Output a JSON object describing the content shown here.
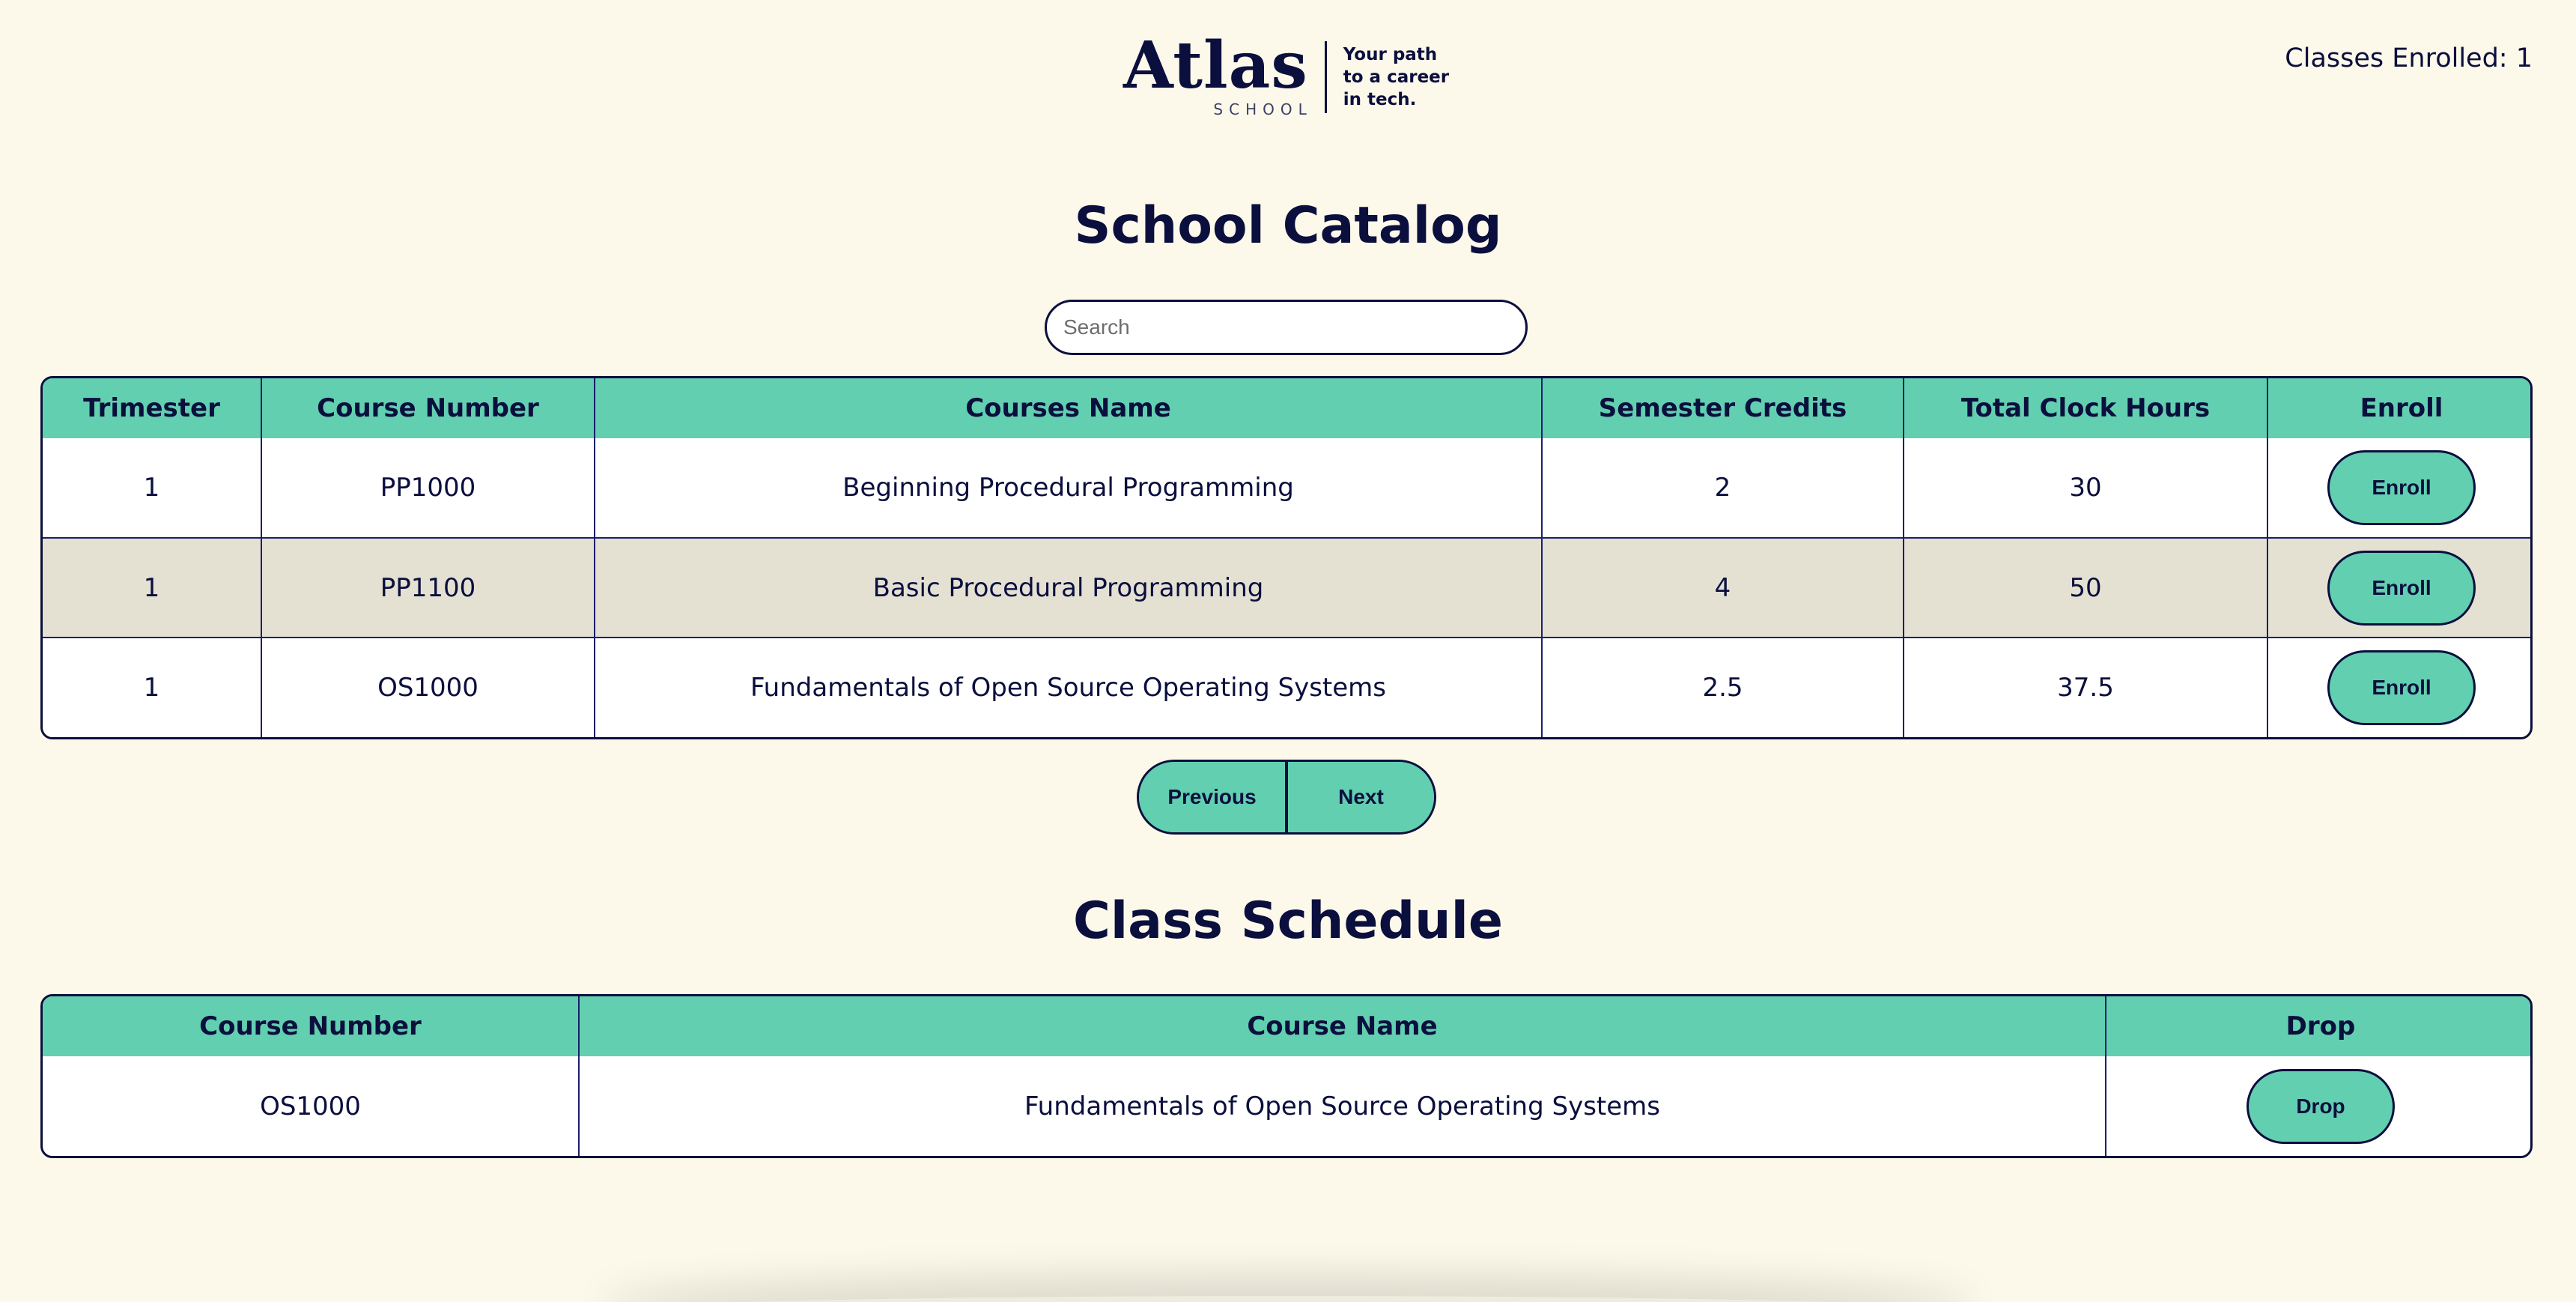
{
  "header": {
    "logo_title": "Atlas",
    "logo_sub": "SCHOOL",
    "logo_tagline": [
      "Your path",
      "to a career",
      "in tech."
    ],
    "enrolled_text": "Classes Enrolled: 1"
  },
  "catalog": {
    "title": "School Catalog",
    "search_placeholder": "Search",
    "columns": [
      "Trimester",
      "Course Number",
      "Courses Name",
      "Semester Credits",
      "Total Clock Hours",
      "Enroll"
    ],
    "rows": [
      {
        "trimester": "1",
        "number": "PP1000",
        "name": "Beginning Procedural Programming",
        "credits": "2",
        "hours": "30",
        "action": "Enroll"
      },
      {
        "trimester": "1",
        "number": "PP1100",
        "name": "Basic Procedural Programming",
        "credits": "4",
        "hours": "50",
        "action": "Enroll"
      },
      {
        "trimester": "1",
        "number": "OS1000",
        "name": "Fundamentals of Open Source Operating Systems",
        "credits": "2.5",
        "hours": "37.5",
        "action": "Enroll"
      }
    ],
    "pager": {
      "previous": "Previous",
      "next": "Next"
    }
  },
  "schedule": {
    "title": "Class Schedule",
    "columns": [
      "Course Number",
      "Course Name",
      "Drop"
    ],
    "rows": [
      {
        "number": "OS1000",
        "name": "Fundamentals of Open Source Operating Systems",
        "action": "Drop"
      }
    ]
  },
  "colors": {
    "background": "#fcf9ea",
    "accent": "#62cfb0",
    "ink": "#0b0f3d",
    "row_alt": "#e4e1d3"
  }
}
